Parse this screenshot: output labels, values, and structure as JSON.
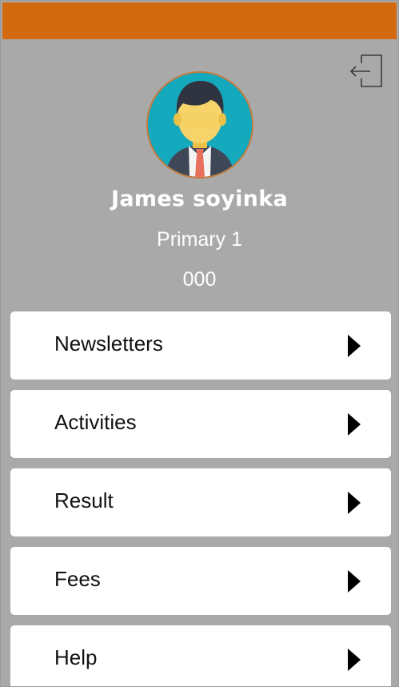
{
  "colors": {
    "status_bar": "#d46a10",
    "background": "#a9a9a9",
    "card": "#ffffff",
    "avatar_bg": "#15a9bd"
  },
  "header": {
    "logout_icon": "logout-icon"
  },
  "profile": {
    "avatar_icon": "student-avatar-icon",
    "name": "James soyinka",
    "class": "Primary 1",
    "id": "000"
  },
  "menu": {
    "items": [
      {
        "label": "Newsletters",
        "icon": "chevron-right-icon"
      },
      {
        "label": "Activities",
        "icon": "chevron-right-icon"
      },
      {
        "label": "Result",
        "icon": "chevron-right-icon"
      },
      {
        "label": "Fees",
        "icon": "chevron-right-icon"
      },
      {
        "label": "Help",
        "icon": "chevron-right-icon"
      }
    ]
  }
}
